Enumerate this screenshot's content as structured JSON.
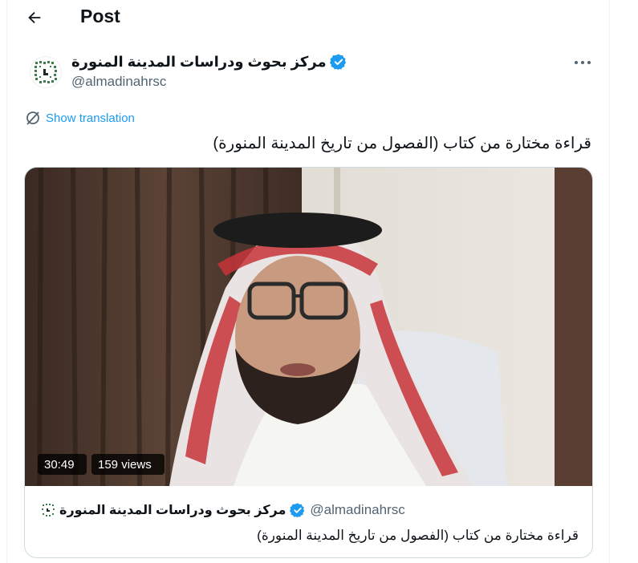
{
  "header": {
    "title": "Post"
  },
  "author": {
    "display_name": "مركز بحوث ودراسات المدينة المنورة",
    "handle": "@almadinahrsc",
    "verified": true
  },
  "translate": {
    "label": "Show translation"
  },
  "post": {
    "text": "قراءة مختارة من كتاب (الفصول من تاريخ المدينة المنورة)"
  },
  "video": {
    "duration": "30:49",
    "views": "159 views"
  },
  "quote": {
    "display_name": "مركز بحوث ودراسات المدينة المنورة",
    "handle": "@almadinahrsc",
    "text": "قراءة مختارة من كتاب (الفصول من تاريخ المدينة المنورة)"
  },
  "colors": {
    "accent": "#1d9bf0",
    "secondary_text": "#536471",
    "border": "#cfd9de"
  },
  "icons": [
    "back-arrow-icon",
    "verified-badge-icon",
    "more-options-icon",
    "translate-icon",
    "logo-icon"
  ]
}
